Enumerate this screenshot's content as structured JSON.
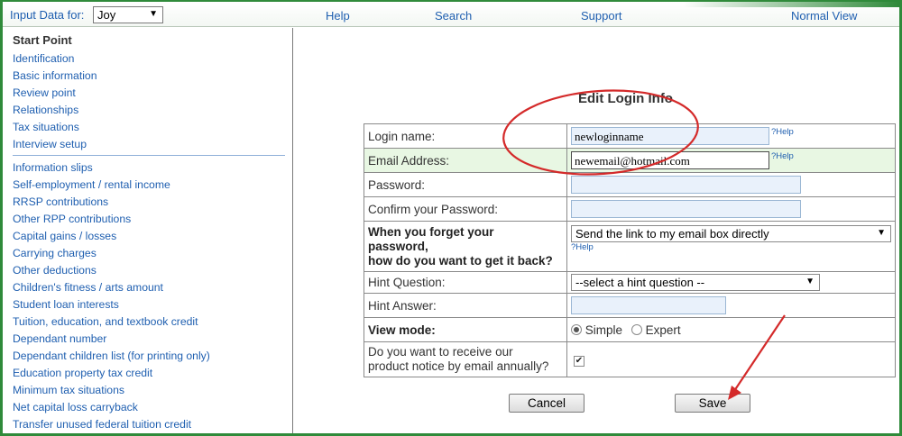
{
  "topbar": {
    "input_label": "Input Data for:",
    "user_select": "Joy",
    "links": {
      "help": "Help",
      "search": "Search",
      "support": "Support",
      "view": "Normal View"
    }
  },
  "sidebar": {
    "title": "Start Point",
    "group1": [
      "Identification",
      "Basic information",
      "Review point",
      "Relationships",
      "Tax situations",
      "Interview setup"
    ],
    "group2": [
      "Information slips",
      "Self-employment / rental income",
      "RRSP contributions",
      "Other RPP contributions",
      "Capital gains / losses",
      "Carrying charges",
      "Other deductions",
      "Children's fitness / arts amount",
      "Student loan interests",
      "Tuition, education, and textbook credit",
      "Dependant number",
      "Dependant children list (for printing only)",
      "Education property tax credit",
      "Minimum tax situations",
      "Net capital loss carryback",
      "Transfer unused federal tuition credit"
    ]
  },
  "form": {
    "title": "Edit Login Info",
    "login_label": "Login name:",
    "login_value": "newloginname",
    "email_label": "Email Address:",
    "email_value": "newemail@hotmail.com",
    "help_link": "?Help",
    "password_label": "Password:",
    "confirm_label": "Confirm your Password:",
    "forget_label_1": "When you forget your",
    "forget_label_2": "password,",
    "forget_label_3": "how do you want to get it back?",
    "forget_option": "Send the link to my email box directly",
    "hint_q_label": "Hint Question:",
    "hint_q_option": "--select a hint question --",
    "hint_a_label": "Hint Answer:",
    "view_mode_label": "View mode:",
    "view_simple": "Simple",
    "view_expert": "Expert",
    "notice_label_1": "Do you want to receive our",
    "notice_label_2": "product notice by email annually?",
    "cancel": "Cancel",
    "save": "Save"
  },
  "colors": {
    "link": "#1f5fb0",
    "frame": "#2f8a3a",
    "highlight_row": "#e8f7e3",
    "annotation": "#d42a2a"
  }
}
